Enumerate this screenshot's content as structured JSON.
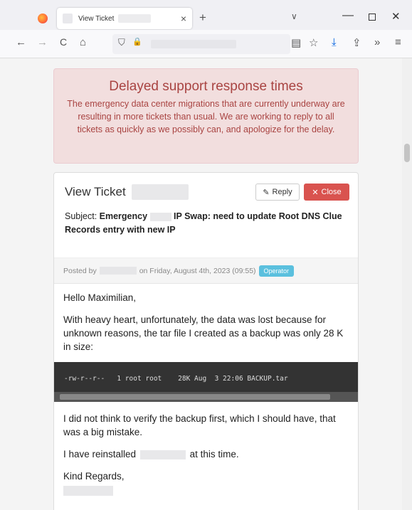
{
  "browser": {
    "tab_title": "View Ticket",
    "tab_close": "×",
    "newtab": "+",
    "tab_list": "∨",
    "min": "—",
    "close": "✕",
    "back": "←",
    "forward": "→",
    "reload": "C",
    "home": "⌂",
    "shield": "⛉",
    "lock": "🔒",
    "reader": "▤",
    "star": "☆",
    "download": "⤓",
    "share": "⇪",
    "overflow": "»",
    "menu": "≡"
  },
  "alert": {
    "title": "Delayed support response times",
    "body": "The emergency data center migrations that are currently underway are resulting in more tickets than usual. We are working to reply to all tickets as quickly as we possibly can, and apologize for the delay."
  },
  "ticket": {
    "title": "View Ticket",
    "reply_label": "Reply",
    "close_label": "Close",
    "subject_prefix": "Subject:",
    "subject_part1": "Emergency",
    "subject_part2": "IP Swap: need to update Root DNS Clue Records entry with new IP",
    "posted_by": "Posted by",
    "posted_on": "on Friday, August 4th, 2023 (09:55)",
    "badge": "Operator",
    "greeting": "Hello Maximilian,",
    "para1": "With heavy heart, unfortunately, the data was lost because for unknown reasons, the tar file I created as a backup was only 28 K in size:",
    "code": "-rw-r--r--   1 root root    28K Aug  3 22:06 BACKUP.tar",
    "para2": "I did not think to verify the backup first, which I should have, that was a big mistake.",
    "para3a": "I have reinstalled",
    "para3b": "at this time.",
    "closing": "Kind Regards,"
  }
}
